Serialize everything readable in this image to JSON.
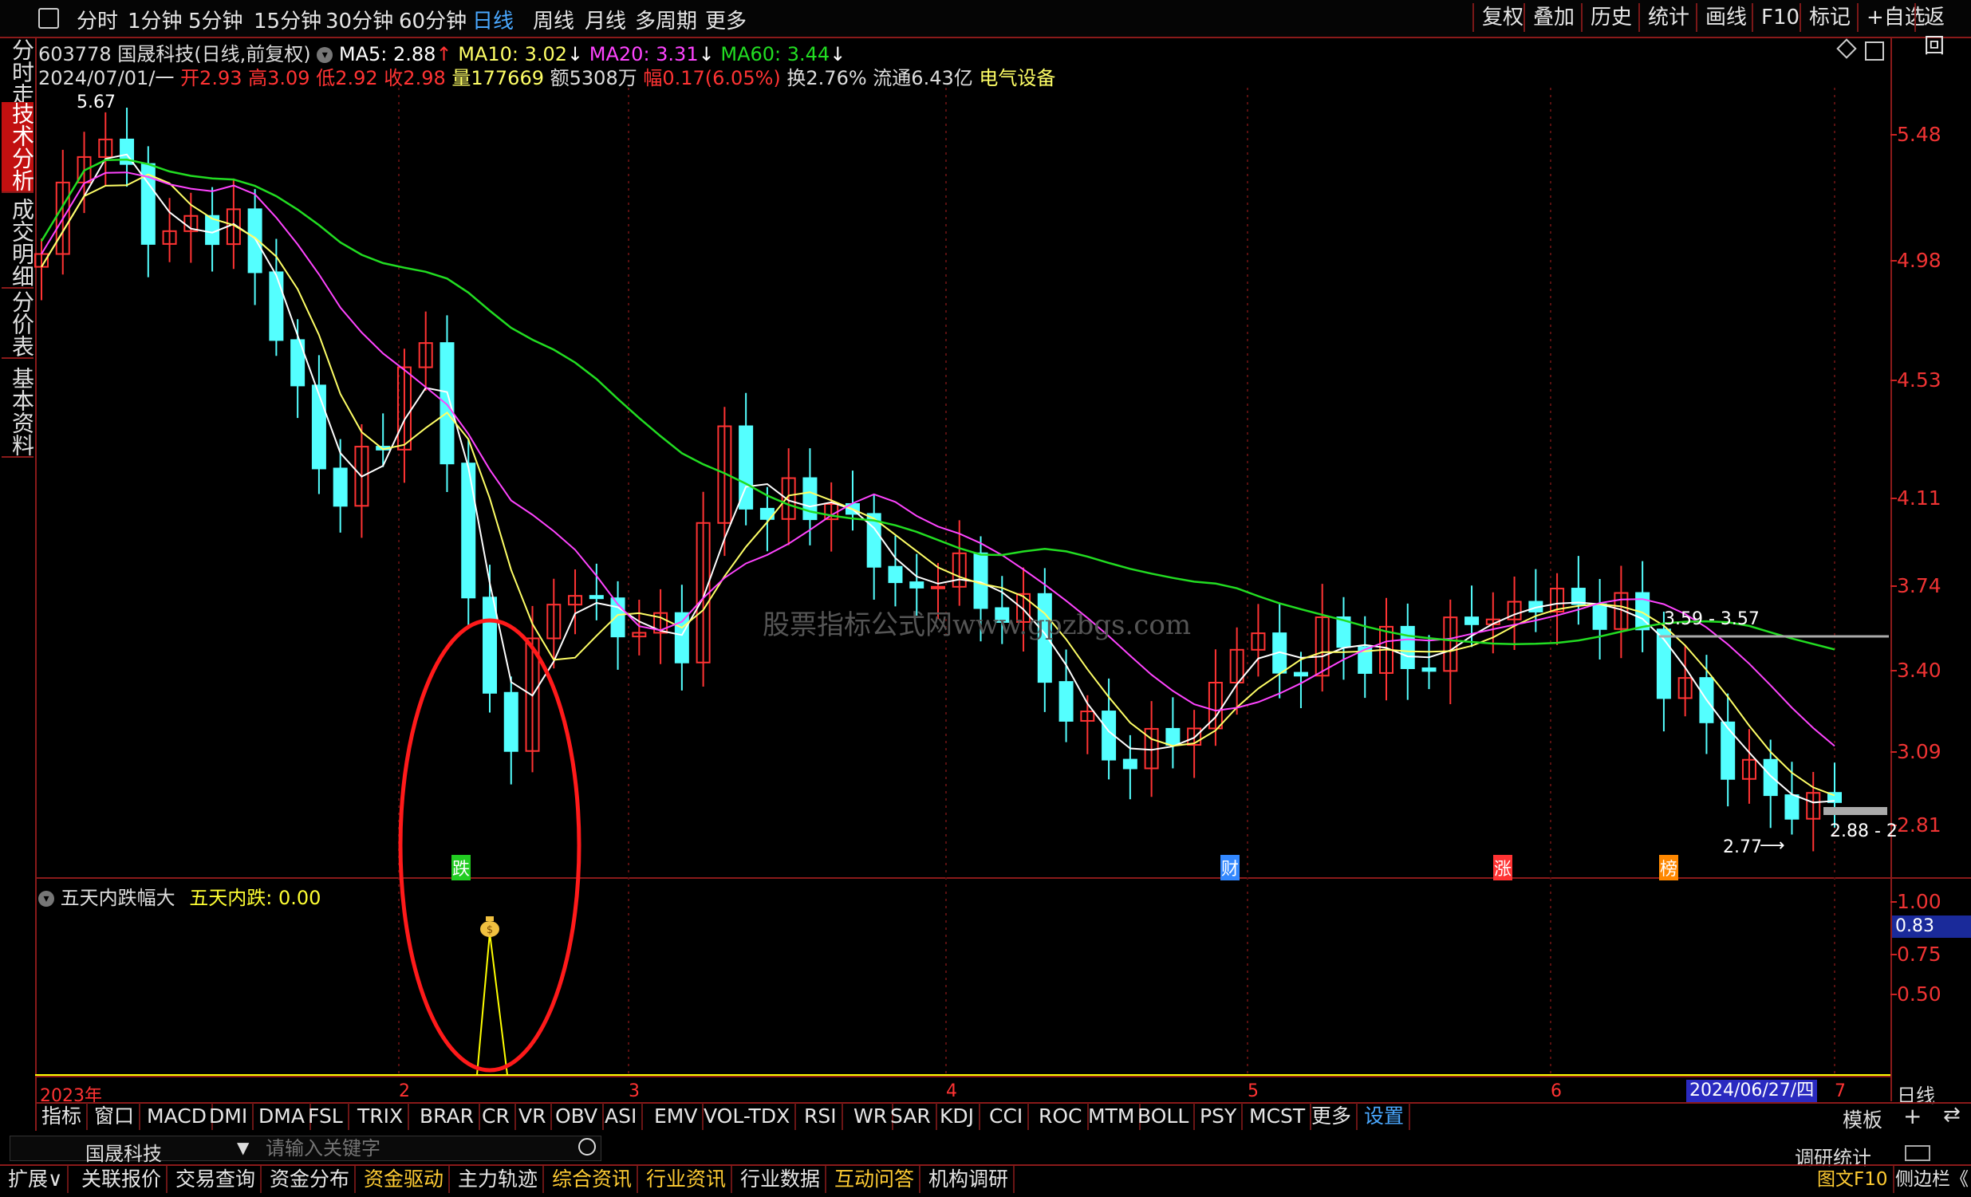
{
  "topbar": {
    "tabs": [
      "分时",
      "1分钟",
      "5分钟",
      "15分钟",
      "30分钟",
      "60分钟",
      "日线",
      "周线",
      "月线",
      "多周期",
      "更多"
    ],
    "active_tab": "日线",
    "right_buttons": [
      "复权",
      "叠加",
      "历史",
      "统计",
      "画线",
      "F10",
      "标记",
      "+自选",
      "返回"
    ]
  },
  "left_tabs": [
    {
      "label": "分时走势",
      "active": false
    },
    {
      "label": "技术分析",
      "active": true
    },
    {
      "label": "成交明细",
      "active": false
    },
    {
      "label": "分价表",
      "active": false
    },
    {
      "label": "基本资料",
      "active": false
    }
  ],
  "stock": {
    "code": "603778",
    "name": "国晟科技",
    "mode": "(日线,前复权)",
    "ma5_label": "MA5: 2.88",
    "ma10_label": "MA10: 3.02",
    "ma20_label": "MA20: 3.31",
    "ma60_label": "MA60: 3.44",
    "date": "2024/07/01/一",
    "open": "开2.93",
    "high": "高3.09",
    "low": "低2.92",
    "close": "收2.98",
    "volume": "量177669",
    "amount": "额5308万",
    "change": "幅0.17(6.05%)",
    "turnover": "换2.76%",
    "float": "流通6.43亿",
    "sector": "电气设备"
  },
  "colors": {
    "up": "#ff3333",
    "down": "#54ffff",
    "ma5": "#ffffff",
    "ma10": "#ffff66",
    "ma20": "#ff44ff",
    "ma60": "#22dd22",
    "indicator": "#ffff00",
    "ellipse": "#ff1a1a"
  },
  "price_axis": [
    "5.48",
    "4.98",
    "4.53",
    "4.11",
    "3.74",
    "3.40",
    "3.09",
    "2.81"
  ],
  "chart_annotations": {
    "high_label": "5.67",
    "range_label": "3.59 - 3.57",
    "low_label": "2.77",
    "last_label": "2.88 - 2",
    "markers": [
      {
        "text": "跌",
        "color": "#22cc22"
      },
      {
        "text": "财",
        "color": "#3388ff"
      },
      {
        "text": "涨",
        "color": "#ff3333"
      },
      {
        "text": "榜",
        "color": "#ff8800"
      }
    ]
  },
  "indicator_panel": {
    "title": "五天内跌幅大",
    "value_label": "五天内跌: 0.00",
    "axis": [
      "1.00",
      "0.75",
      "0.50"
    ],
    "current_value": "0.83",
    "icon": "money-bag-icon"
  },
  "watermark": "股票指标公式网www.gpzbgs.com",
  "x_axis": {
    "labels": [
      "2023年",
      "2",
      "3",
      "4",
      "5",
      "6",
      "7"
    ],
    "cursor_date": "2024/06/27/四",
    "period": "日线"
  },
  "indicator_tabs": [
    "指标",
    "窗口",
    "MACD",
    "DMI",
    "DMA",
    "FSL",
    "TRIX",
    "BRAR",
    "CR",
    "VR",
    "OBV",
    "ASI",
    "EMV",
    "VOL-TDX",
    "RSI",
    "WR",
    "SAR",
    "KDJ",
    "CCI",
    "ROC",
    "MTM",
    "BOLL",
    "PSY",
    "MCST",
    "更多",
    "设置"
  ],
  "indicator_tabs_selected": "设置",
  "template_button": "模板",
  "search": {
    "stock_name": "国晟科技",
    "placeholder": "请输入关键字",
    "right_label": "调研统计"
  },
  "footer_tabs": [
    {
      "label": "扩展∨",
      "color": "#e6e6e6"
    },
    {
      "label": "关联报价",
      "color": "#e6e6e6"
    },
    {
      "label": "交易查询",
      "color": "#e6e6e6"
    },
    {
      "label": "资金分布",
      "color": "#e6e6e6"
    },
    {
      "label": "资金驱动",
      "color": "#ffcc33"
    },
    {
      "label": "主力轨迹",
      "color": "#e6e6e6"
    },
    {
      "label": "综合资讯",
      "color": "#ffcc33"
    },
    {
      "label": "行业资讯",
      "color": "#ffcc33"
    },
    {
      "label": "行业数据",
      "color": "#e6e6e6"
    },
    {
      "label": "互动问答",
      "color": "#ffcc33"
    },
    {
      "label": "机构调研",
      "color": "#e6e6e6"
    }
  ],
  "footer_right": [
    "图文F10",
    "侧边栏《"
  ]
}
